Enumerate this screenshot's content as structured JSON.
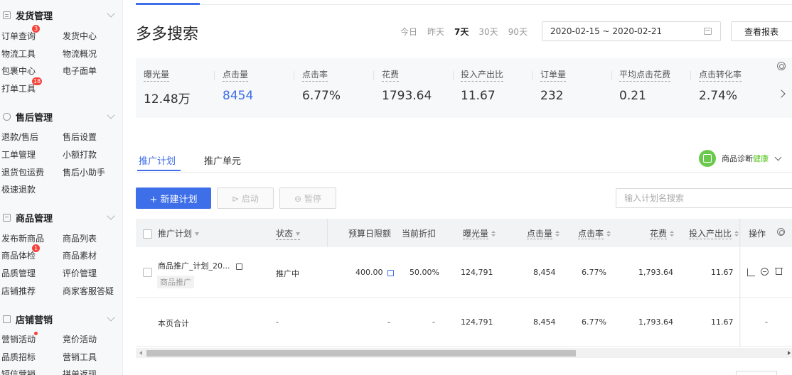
{
  "sidebar": {
    "sections": [
      {
        "title": "发货管理",
        "icon": "doc-icon",
        "items": [
          {
            "label": "订单查询",
            "badge": "3"
          },
          {
            "label": "发货中心"
          },
          {
            "label": "物流工具"
          },
          {
            "label": "物流概况"
          },
          {
            "label": "包裹中心"
          },
          {
            "label": "电子面单"
          },
          {
            "label": "打单工具",
            "badge": "18"
          }
        ]
      },
      {
        "title": "售后管理",
        "icon": "shield-icon",
        "items": [
          {
            "label": "退款/售后"
          },
          {
            "label": "售后设置"
          },
          {
            "label": "工单管理"
          },
          {
            "label": "小额打款"
          },
          {
            "label": "退货包运费"
          },
          {
            "label": "售后小助手"
          },
          {
            "label": "极速退款"
          }
        ]
      },
      {
        "title": "商品管理",
        "icon": "box-icon",
        "items": [
          {
            "label": "发布新商品"
          },
          {
            "label": "商品列表"
          },
          {
            "label": "商品体检",
            "badge": "1"
          },
          {
            "label": "商品素材"
          },
          {
            "label": "品质管理"
          },
          {
            "label": "评价管理"
          },
          {
            "label": "店铺推荐"
          },
          {
            "label": "商家客服答疑"
          }
        ]
      },
      {
        "title": "店铺营销",
        "icon": "shop-icon",
        "items": [
          {
            "label": "营销活动",
            "dot": true
          },
          {
            "label": "竞价活动"
          },
          {
            "label": "品质招标"
          },
          {
            "label": "营销工具"
          },
          {
            "label": "短信营销"
          },
          {
            "label": "拼单返现"
          }
        ]
      }
    ]
  },
  "header": {
    "title": "多多搜索",
    "date_tabs": [
      {
        "label": "今日",
        "active": false
      },
      {
        "label": "昨天",
        "active": false
      },
      {
        "label": "7天",
        "active": true
      },
      {
        "label": "30天",
        "active": false
      },
      {
        "label": "90天",
        "active": false
      }
    ],
    "date_range": "2020-02-15 ~ 2020-02-21",
    "report_button": "查看报表"
  },
  "metrics": [
    {
      "label": "曝光量",
      "value": "12.48万"
    },
    {
      "label": "点击量",
      "value": "8454",
      "highlight": true
    },
    {
      "label": "点击率",
      "value": "6.77%"
    },
    {
      "label": "花费",
      "value": "1793.64"
    },
    {
      "label": "投入产出比",
      "value": "11.67"
    },
    {
      "label": "订单量",
      "value": "232"
    },
    {
      "label": "平均点击花费",
      "value": "0.21"
    },
    {
      "label": "点击转化率",
      "value": "2.74%"
    }
  ],
  "subtabs": [
    {
      "label": "推广计划",
      "active": true
    },
    {
      "label": "推广单元",
      "active": false
    }
  ],
  "diagnosis": {
    "label": "商品诊断",
    "status": "健康"
  },
  "toolbar": {
    "new_button": "+ 新建计划",
    "start_button": "启动",
    "pause_button": "暂停",
    "search_placeholder": "输入计划名搜索"
  },
  "table": {
    "headers": {
      "plan": "推广计划",
      "status": "状态",
      "budget": "预算日限额",
      "discount": "当前折扣",
      "impressions": "曝光量",
      "clicks": "点击量",
      "ctr": "点击率",
      "cost": "花费",
      "roi": "投入产出比",
      "ops": "操作"
    },
    "rows": [
      {
        "plan": "商品推广_计划_20...",
        "plan_tag": "商品推广",
        "status": "推广中",
        "budget": "400.00",
        "discount": "50.00%",
        "impressions": "124,791",
        "clicks": "8,454",
        "ctr": "6.77%",
        "cost": "1,793.64",
        "roi": "11.67"
      }
    ],
    "total": {
      "plan": "本页合计",
      "status": "-",
      "budget": "-",
      "discount": "-",
      "impressions": "124,791",
      "clicks": "8,454",
      "ctr": "6.77%",
      "cost": "1,793.64",
      "roi": "11.67",
      "ops": "-"
    }
  },
  "colors": {
    "accent": "#3e6ee8",
    "badge": "#f5433b",
    "healthy": "#52c41a"
  }
}
